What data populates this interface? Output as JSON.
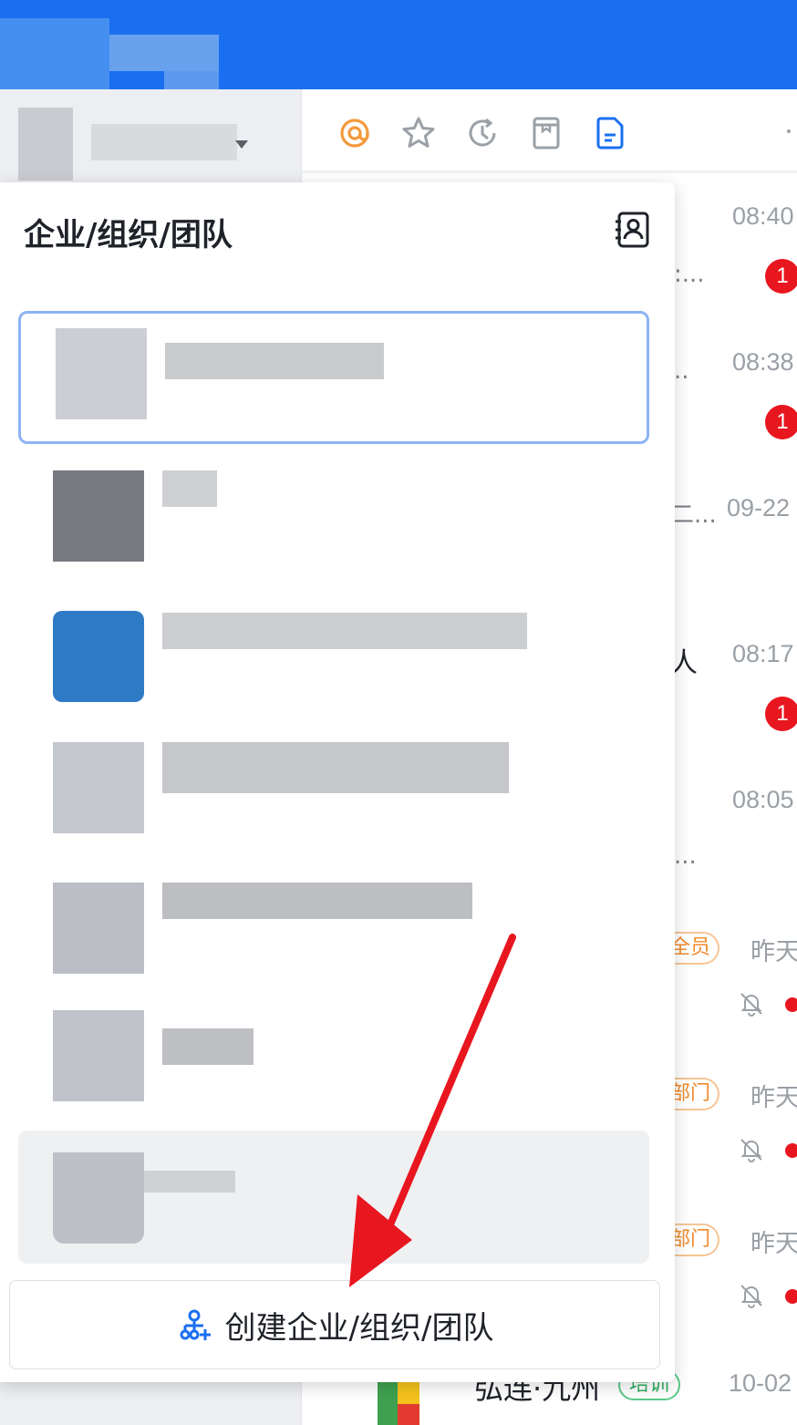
{
  "popup": {
    "title": "企业/组织/团队",
    "create_label": "创建企业/组织/团队"
  },
  "toolbar": {
    "icons": [
      "at-icon",
      "star-icon",
      "history-icon",
      "inbox-icon",
      "document-icon"
    ]
  },
  "chats": [
    {
      "time": "08:40",
      "badge": "1",
      "frag": ":..."
    },
    {
      "time": "08:38",
      "badge": "1",
      "frag": ".."
    },
    {
      "time": "09-22",
      "frag": "二..."
    },
    {
      "time": "08:17",
      "badge": "1",
      "frag": "人"
    },
    {
      "time": "08:05",
      "frag": "..."
    },
    {
      "time": "昨天",
      "tag": "全员"
    },
    {
      "time": "昨天",
      "tag": "部门"
    },
    {
      "time": "昨天",
      "tag": "部门"
    },
    {
      "time": "10-02",
      "name": "弘连·九州",
      "tag": "培训"
    }
  ],
  "colors": {
    "brand_blue": "#1a6ff0",
    "badge_red": "#e8161f",
    "selected_border": "#8db3f4",
    "arrow_red": "#e8161f"
  }
}
